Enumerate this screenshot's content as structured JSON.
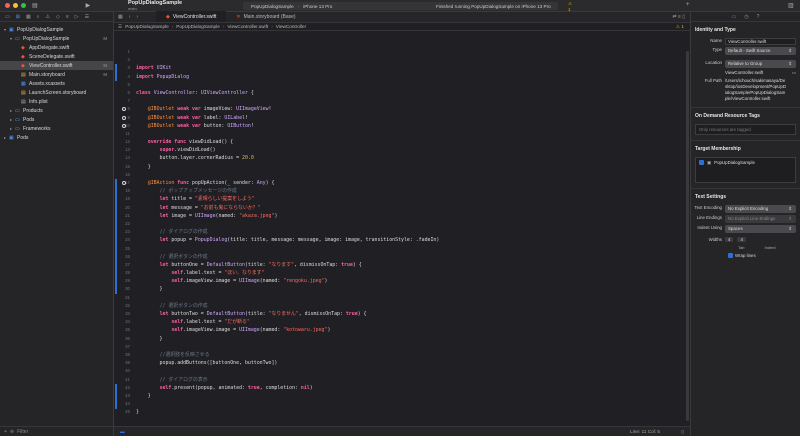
{
  "titlebar": {
    "scheme_name": "PopUpDialogSample",
    "branch": "main",
    "target": "PopUpDialogSample",
    "device": "iPhone 13 Pro",
    "run_status": "Finished running PopUpDialogSample on iPhone 13 Pro",
    "warning_count": "1"
  },
  "navigator": {
    "items": [
      {
        "label": "PopUpDialogSample",
        "badge": "",
        "level": 0,
        "icon": "project-icon",
        "arrow": "▾"
      },
      {
        "label": "PopUpDialogSample",
        "badge": "M",
        "level": 1,
        "icon": "folder-icon",
        "arrow": "▾"
      },
      {
        "label": "AppDelegate.swift",
        "badge": "",
        "level": 2,
        "icon": "swift-file-icon",
        "arrow": ""
      },
      {
        "label": "SceneDelegate.swift",
        "badge": "",
        "level": 2,
        "icon": "swift-file-icon",
        "arrow": ""
      },
      {
        "label": "ViewController.swift",
        "badge": "M",
        "level": 2,
        "icon": "swift-file-icon",
        "arrow": "",
        "selected": true
      },
      {
        "label": "Main.storyboard",
        "badge": "M",
        "level": 2,
        "icon": "storyboard-icon",
        "arrow": ""
      },
      {
        "label": "Assets.xcassets",
        "badge": "",
        "level": 2,
        "icon": "assets-icon",
        "arrow": ""
      },
      {
        "label": "LaunchScreen.storyboard",
        "badge": "",
        "level": 2,
        "icon": "storyboard-icon",
        "arrow": ""
      },
      {
        "label": "Info.plist",
        "badge": "",
        "level": 2,
        "icon": "plist-icon",
        "arrow": ""
      },
      {
        "label": "Products",
        "badge": "",
        "level": 1,
        "icon": "folder-icon",
        "arrow": "▸"
      },
      {
        "label": "Pods",
        "badge": "",
        "level": 1,
        "icon": "folder-icon",
        "arrow": "▸"
      },
      {
        "label": "Frameworks",
        "badge": "",
        "level": 1,
        "icon": "folder-icon",
        "arrow": "▸"
      },
      {
        "label": "Pods",
        "badge": "",
        "level": 0,
        "icon": "project-icon",
        "arrow": "▸"
      }
    ],
    "filter_placeholder": "Filter"
  },
  "editor": {
    "tabs": [
      {
        "label": "ViewController.swift",
        "active": true,
        "icon": "swift-file-icon"
      },
      {
        "label": "Main.storyboard (Base)",
        "active": false,
        "icon": "storyboard-icon"
      }
    ],
    "breadcrumbs": [
      "PopUpDialogSample",
      "PopUpDialogSample",
      "ViewController.swift",
      "ViewController"
    ],
    "warning_count": "1",
    "code_lines": [
      "",
      "",
      "import UIKit",
      "import PopupDialog",
      "",
      "class ViewController: UIViewController {",
      "",
      "    @IBOutlet weak var imageView: UIImageView!",
      "    @IBOutlet weak var label: UILabel!",
      "    @IBOutlet weak var button: UIButton!",
      "",
      "    override func viewDidLoad() {",
      "        super.viewDidLoad()",
      "        button.layer.cornerRadius = 20.0",
      "    }",
      "",
      "    @IBAction func popUpAction(_ sender: Any) {",
      "        // ポップアップメッセージの作成",
      "        let title = \"素晴らしい提案をしよう\"",
      "        let message = \"お前も鬼にならないか？\"",
      "        let image = UIImage(named: \"akaza.jpeg\")",
      "",
      "        // ダイアログの作成",
      "        let popup = PopupDialog(title: title, message: message, image: image, transitionStyle: .fadeIn)",
      "",
      "        // 選択ボタンの作成",
      "        let buttonOne = DefaultButton(title: \"なります\", dismissOnTap: true) {",
      "            self.label.text = \"ほい、なります\"",
      "            self.imageView.image = UIImage(named: \"rengoku.jpeg\")",
      "        }",
      "",
      "        // 選択ボタンの作成",
      "        let buttonTwo = DefaultButton(title: \"なりません\", dismissOnTap: true) {",
      "            self.label.text = \"だが断る\"",
      "            self.imageView.image = UIImage(named: \"kotowaru.jpeg\")",
      "        }",
      "",
      "        //選択肢を反映させる",
      "        popup.addButtons([buttonOne, buttonTwo])",
      "",
      "        // ダイアログの表示",
      "        self.present(popup, animated: true, completion: nil)",
      "    }",
      "",
      "}"
    ],
    "status_position": "Line: 11  Col: 5"
  },
  "inspector": {
    "identity_title": "Identity and Type",
    "name_label": "Name",
    "name_value": "ViewController.swift",
    "type_label": "Type",
    "type_value": "Default - Swift Source",
    "location_label": "Location",
    "location_value": "Relative to Group",
    "location_file": "ViewController.swift",
    "fullpath_label": "Full Path",
    "fullpath_value": "/Users/ichouch/sakimasaya/Desktop/iosDevelopment/PopUpDialogSample/PopUpDialogSample/ViewController.swift",
    "odr_title": "On Demand Resource Tags",
    "odr_placeholder": "Only resources are tagged",
    "target_title": "Target Membership",
    "target_item": "PopUpDialogSample",
    "text_title": "Text Settings",
    "encoding_label": "Text Encoding",
    "encoding_value": "No Explicit Encoding",
    "endings_label": "Line Endings",
    "endings_value": "No Explicit Line Endings",
    "indent_label": "Indent Using",
    "indent_value": "Spaces",
    "widths_label": "Widths",
    "tab_width": "4",
    "indent_width": "4",
    "tab_label": "Tab",
    "indent_sub_label": "Indent",
    "wrap_label": "Wrap lines"
  },
  "colors": {
    "accent": "#2e6fd6",
    "warning": "#f4b400",
    "keyword": "#fc5fa3",
    "string": "#fc6a5d",
    "comment": "#6c7986"
  }
}
